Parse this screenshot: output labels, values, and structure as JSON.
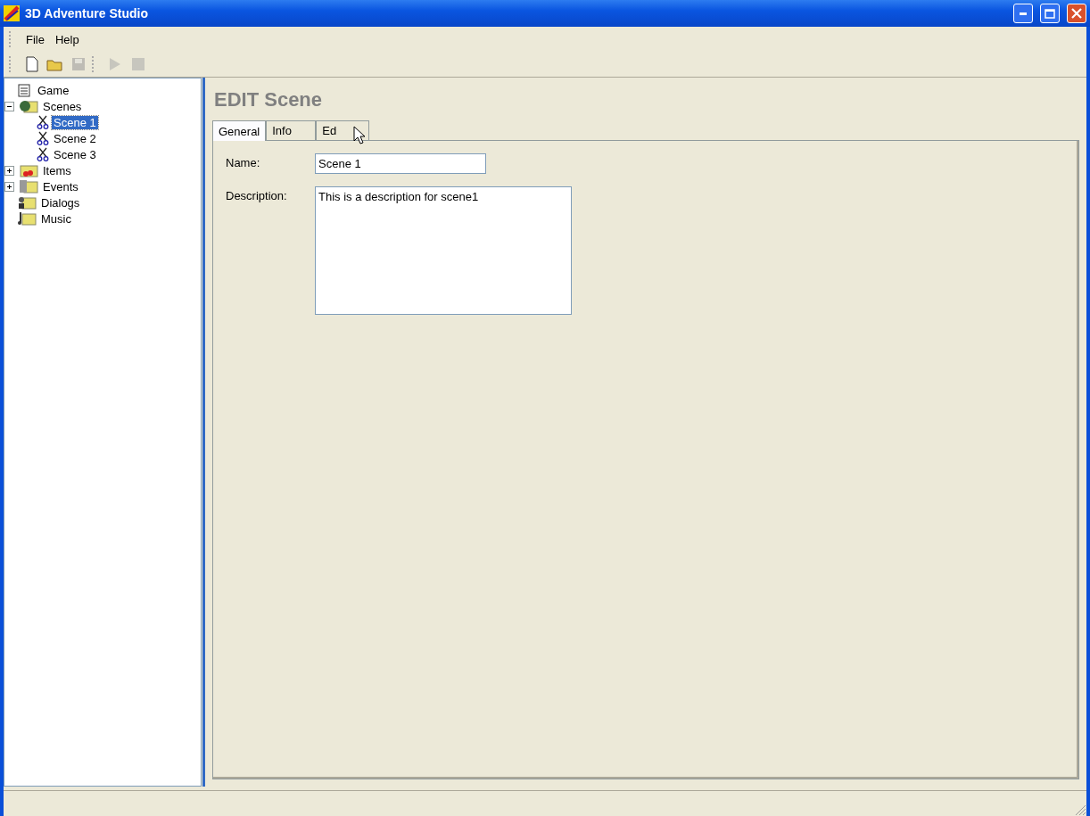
{
  "window": {
    "title": "3D Adventure Studio"
  },
  "menu": [
    "File",
    "Help"
  ],
  "toolbar": [
    {
      "kind": "new",
      "disabled": false
    },
    {
      "kind": "open",
      "disabled": false
    },
    {
      "kind": "save",
      "disabled": true
    },
    {
      "kind": "separator"
    },
    {
      "kind": "play",
      "disabled": true
    },
    {
      "kind": "stop",
      "disabled": true
    }
  ],
  "tree": [
    {
      "label": "Game",
      "kind": "game",
      "selected": false
    },
    {
      "label": "Scenes",
      "kind": "scenes",
      "selected": false,
      "expanded": true,
      "children": [
        {
          "label": "Scene 1",
          "kind": "scene",
          "selected": true
        },
        {
          "label": "Scene 2",
          "kind": "scene",
          "selected": false
        },
        {
          "label": "Scene 3",
          "kind": "scene",
          "selected": false
        }
      ]
    },
    {
      "label": "Items",
      "kind": "items",
      "selected": false,
      "expanded": false
    },
    {
      "label": "Events",
      "kind": "events",
      "selected": false,
      "expanded": false
    },
    {
      "label": "Dialogs",
      "kind": "dialogs",
      "selected": false
    },
    {
      "label": "Music",
      "kind": "music",
      "selected": false
    }
  ],
  "editor": {
    "heading": "EDIT Scene",
    "tabs": [
      {
        "label": "General",
        "selected": true
      },
      {
        "label": "Info",
        "selected": false
      },
      {
        "label": "Ed",
        "selected": false
      }
    ],
    "fields": [
      {
        "label": "Name:",
        "value": "Scene 1",
        "kind": "line"
      },
      {
        "label": "Description:",
        "value": "This is a description for scene1",
        "kind": "area"
      }
    ]
  }
}
